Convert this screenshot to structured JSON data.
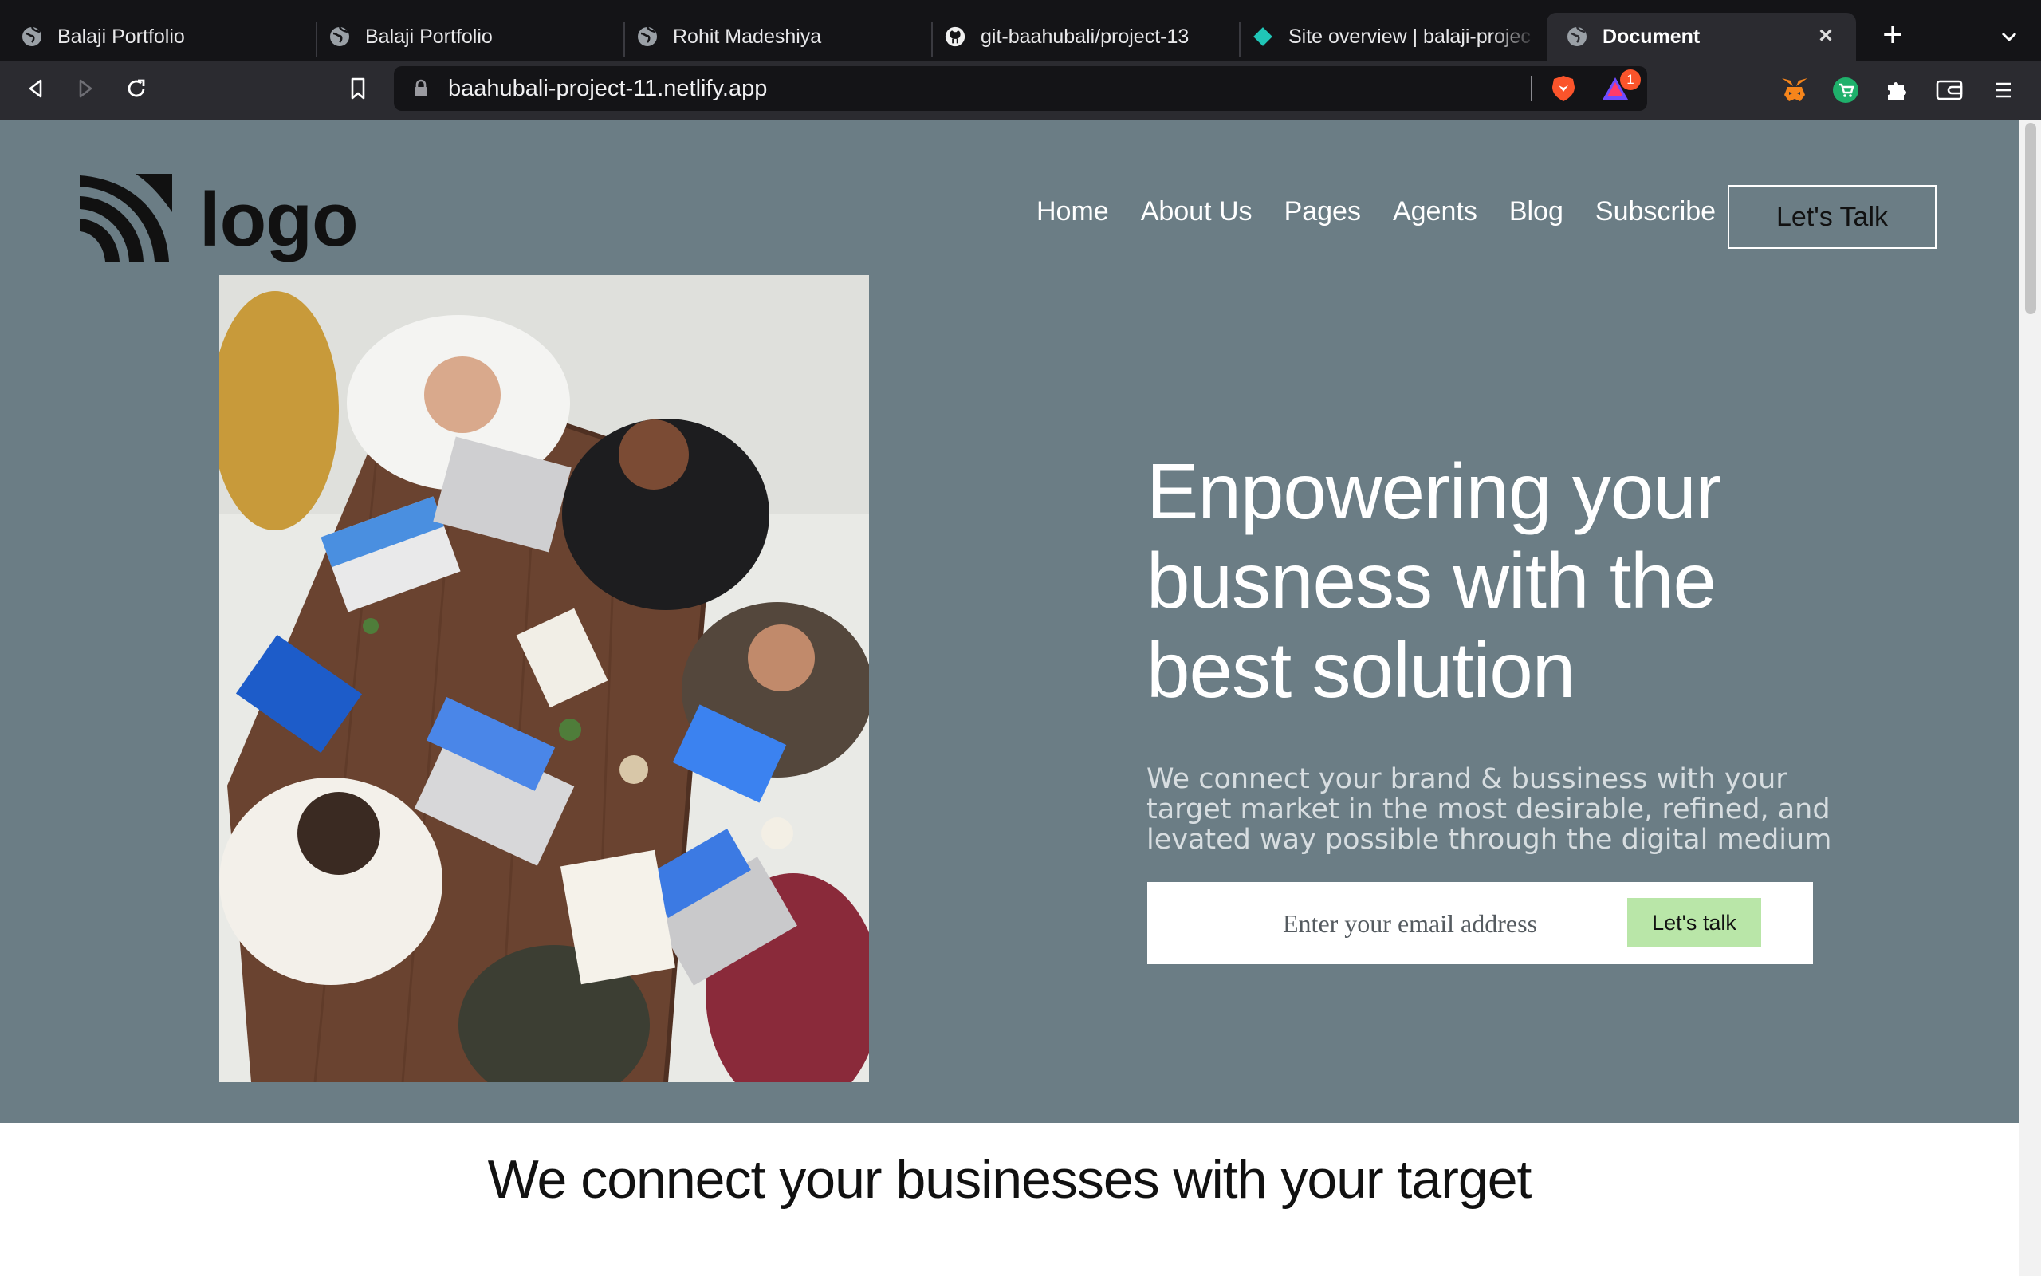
{
  "browser": {
    "tabs": [
      {
        "title": "Balaji Portfolio",
        "icon": "globe-icon"
      },
      {
        "title": "Balaji Portfolio",
        "icon": "globe-icon"
      },
      {
        "title": "Rohit Madeshiya",
        "icon": "globe-icon"
      },
      {
        "title": "git-baahubali/project-13",
        "icon": "github-icon"
      },
      {
        "title": "Site overview | balaji-projec",
        "icon": "netlify-icon"
      },
      {
        "title": "Document",
        "icon": "globe-icon",
        "active": true
      }
    ],
    "url": "baahubali-project-11.netlify.app",
    "notification_count": "1",
    "accent": "#fb542b"
  },
  "site": {
    "logo_text": "logo",
    "nav": [
      "Home",
      "About Us",
      "Pages",
      "Agents",
      "Blog",
      "Subscribe"
    ],
    "cta_label": "Let's Talk",
    "hero": {
      "headline": "Enpowering your busness with the best solution",
      "subtext": "We connect your brand & bussiness with your target market in the most desirable, refined, and levated way possible through the digital medium",
      "email_placeholder": "Enter your email address",
      "submit_label": "Let's talk",
      "background": "#6b7d85",
      "button_color": "#b9e6a8"
    },
    "section_title": "We connect your businesses with your target"
  }
}
